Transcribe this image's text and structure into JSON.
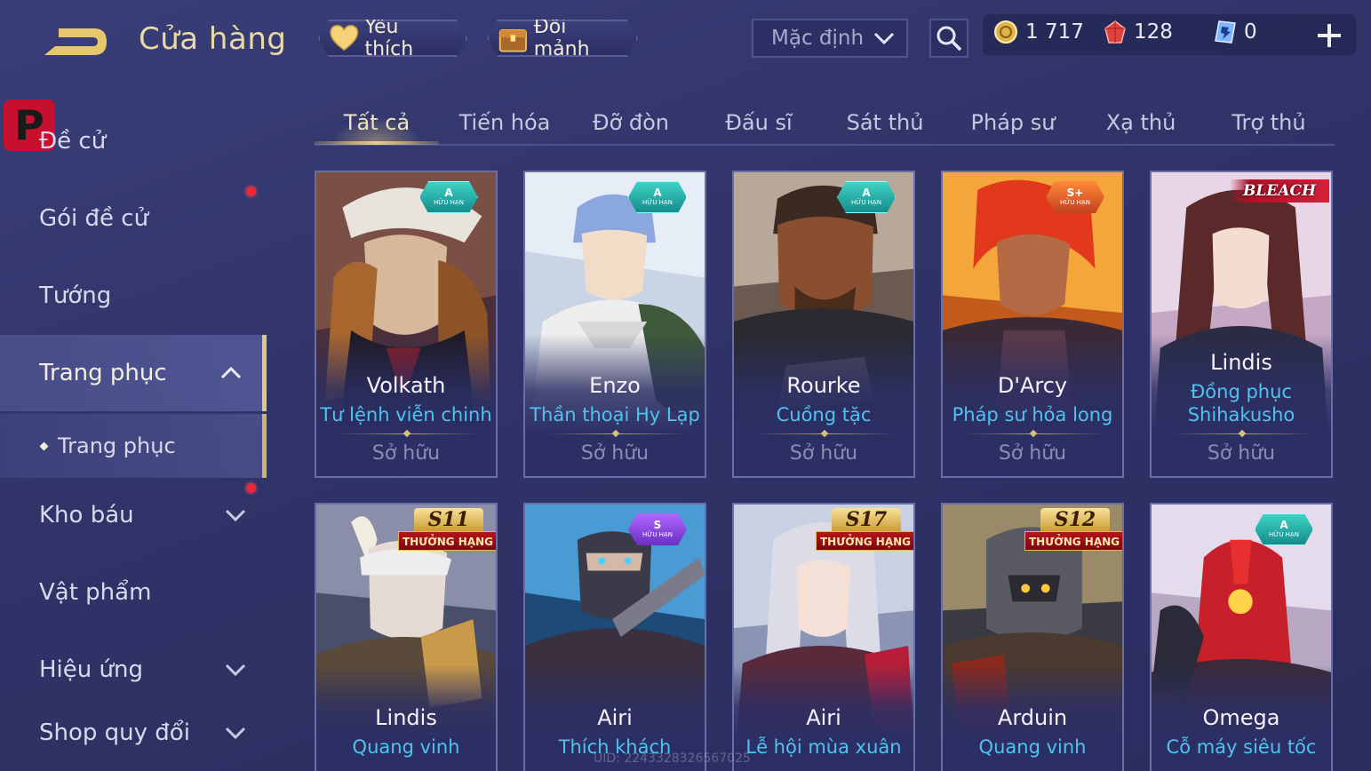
{
  "header": {
    "title": "Cửa hàng",
    "favorites_label": "Yêu thích",
    "shard_exchange_label": "Đổi mảnh",
    "sort_value": "Mặc định"
  },
  "currency": {
    "gold": "1 717",
    "ruby": "128",
    "voucher": "0"
  },
  "sidebar": {
    "logo_letter": "P",
    "items": [
      {
        "label": "Đề cử"
      },
      {
        "label": "Gói đề cử"
      },
      {
        "label": "Tướng"
      },
      {
        "label": "Trang phục"
      },
      {
        "label": "Trang phục"
      },
      {
        "label": "Kho báu"
      },
      {
        "label": "Vật phẩm"
      },
      {
        "label": "Hiệu ứng"
      },
      {
        "label": "Shop quy đổi"
      }
    ]
  },
  "tabs": [
    "Tất cả",
    "Tiến hóa",
    "Đỡ đòn",
    "Đấu sĩ",
    "Sát thủ",
    "Pháp sư",
    "Xạ thủ",
    "Trợ thủ"
  ],
  "owned_label": "Sở hữu",
  "badges": {
    "limited": "HỮU HẠN",
    "ranked": "THƯỞNG HẠNG",
    "bleach": "BLEACH"
  },
  "cards": [
    {
      "hero": "Volkath",
      "skin": "Tư lệnh viễn chinh",
      "grade": "A",
      "season": ""
    },
    {
      "hero": "Enzo",
      "skin": "Thần thoại Hy Lạp",
      "grade": "A",
      "season": ""
    },
    {
      "hero": "Rourke",
      "skin": "Cuồng tặc",
      "grade": "A",
      "season": ""
    },
    {
      "hero": "D'Arcy",
      "skin": "Pháp sư hỏa long",
      "grade": "S+",
      "season": ""
    },
    {
      "hero": "Lindis",
      "skin": "Đồng phục Shihakusho",
      "grade": "",
      "season": ""
    },
    {
      "hero": "Lindis",
      "skin": "Quang vinh",
      "grade": "",
      "season": "S11"
    },
    {
      "hero": "Airi",
      "skin": "Thích khách",
      "grade": "S",
      "season": ""
    },
    {
      "hero": "Airi",
      "skin": "Lễ hội mùa xuân",
      "grade": "",
      "season": "S17"
    },
    {
      "hero": "Arduin",
      "skin": "Quang vinh",
      "grade": "",
      "season": "S12"
    },
    {
      "hero": "Omega",
      "skin": "Cỗ máy siêu tốc",
      "grade": "A",
      "season": ""
    }
  ],
  "uid_watermark": "UID: 2243328326567025",
  "colors": {
    "accent_gold": "#e8cc7e",
    "skin_name_blue": "#4fc3f0",
    "notification_red": "#e6283a",
    "background": "#2f3367"
  },
  "icons": {
    "back": "back-arrow-icon",
    "favorite": "heart-icon",
    "shard": "shard-chest-icon",
    "search": "search-icon",
    "gold": "gold-coin-icon",
    "ruby": "ruby-gem-icon",
    "voucher": "voucher-icon",
    "add": "plus-icon"
  }
}
